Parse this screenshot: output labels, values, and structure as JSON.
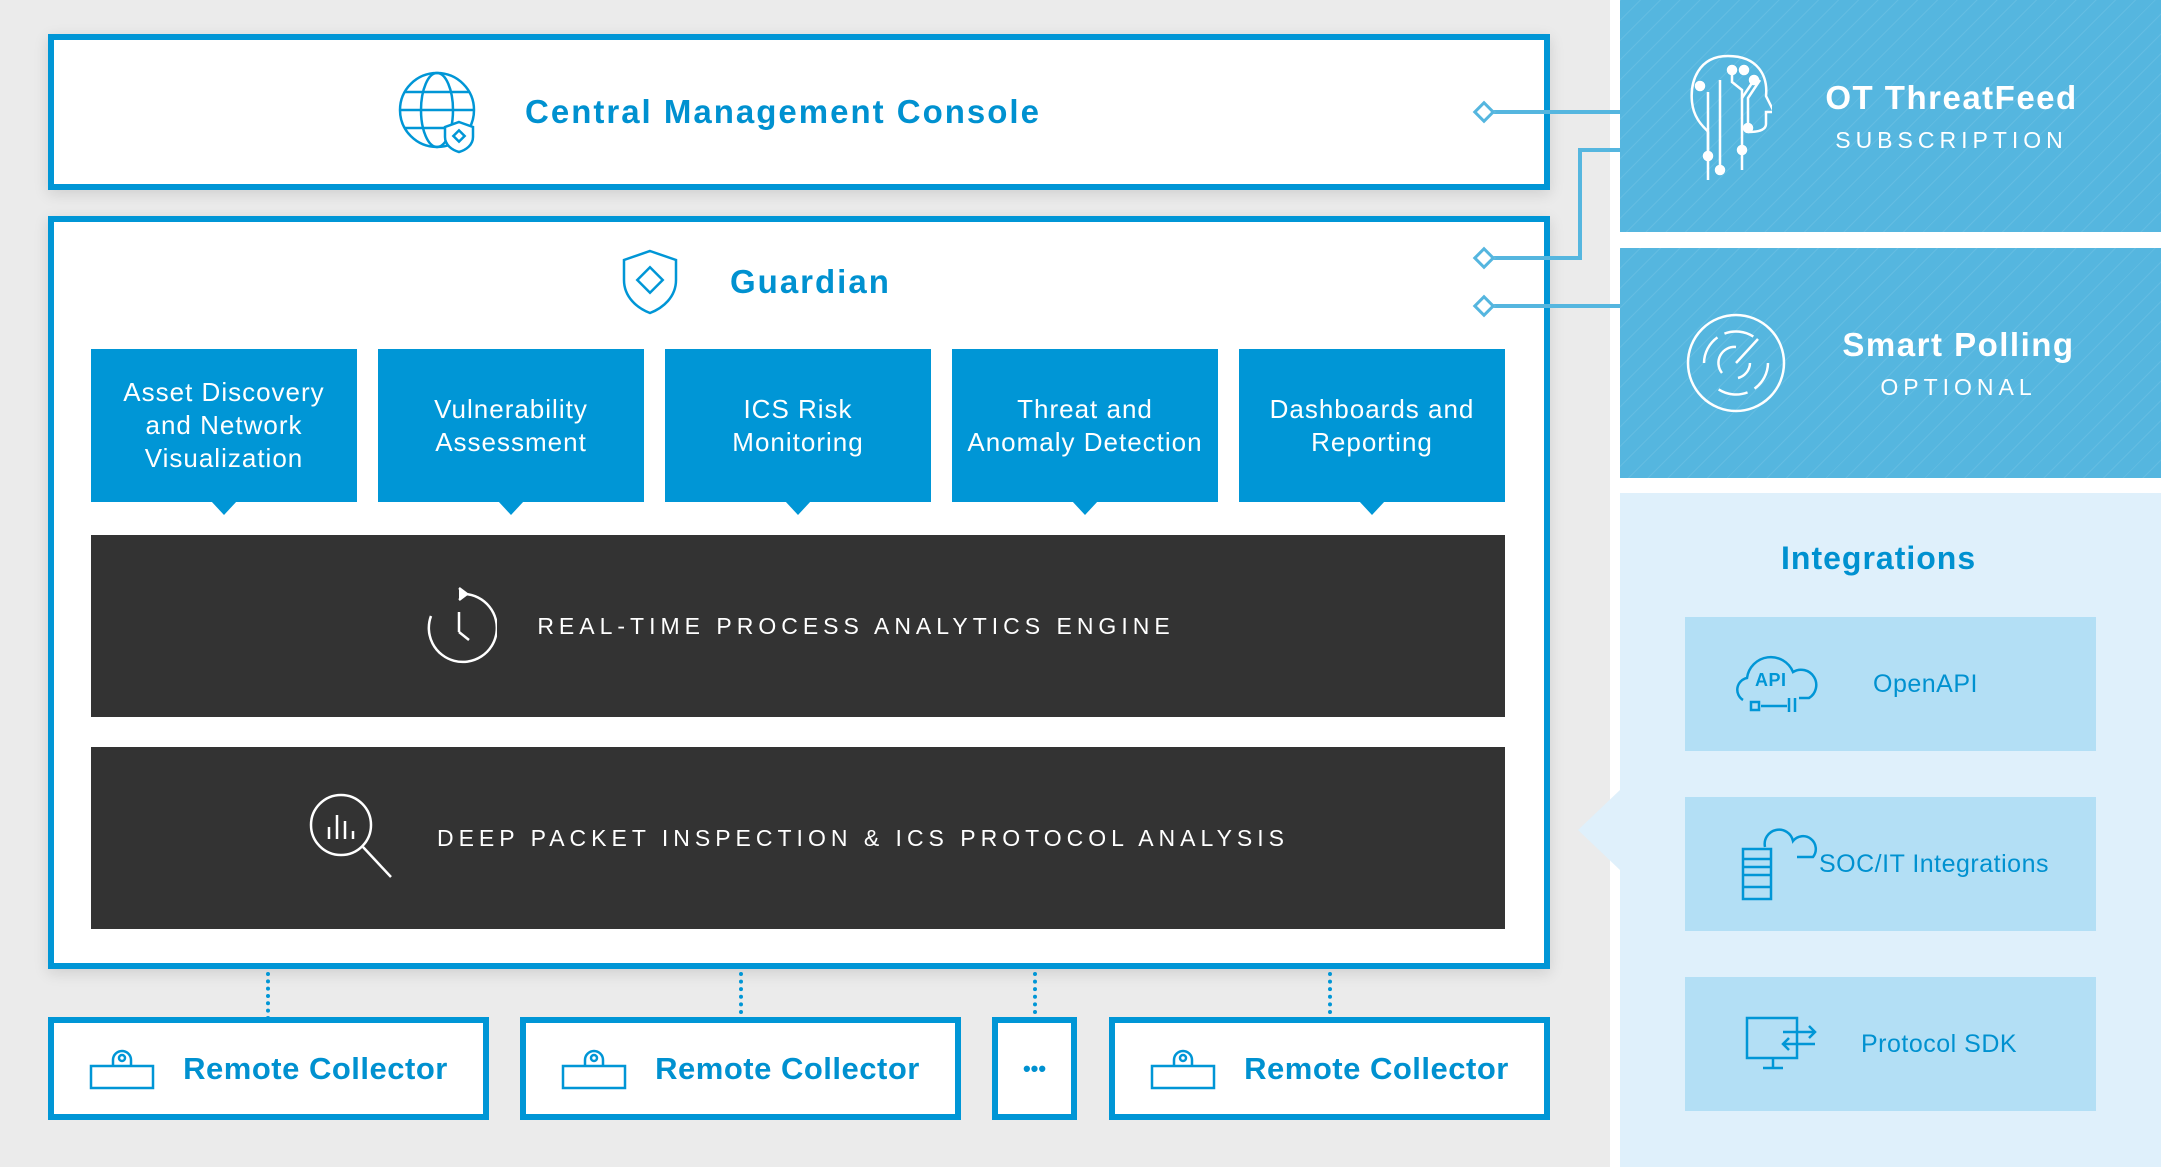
{
  "console": {
    "title": "Central Management Console",
    "icon": "globe-shield-icon"
  },
  "guardian": {
    "title": "Guardian",
    "icon": "shield-diamond-icon",
    "modules": [
      {
        "label": "Asset Discovery and Network Visualization"
      },
      {
        "label": "Vulnerability Assessment"
      },
      {
        "label": "ICS Risk Monitoring"
      },
      {
        "label": "Threat and Anomaly Detection"
      },
      {
        "label": "Dashboards and Reporting"
      }
    ],
    "engines": [
      {
        "label": "REAL-TIME PROCESS ANALYTICS ENGINE",
        "icon": "clock-refresh-icon"
      },
      {
        "label": "DEEP PACKET INSPECTION & ICS PROTOCOL ANALYSIS",
        "icon": "magnifier-chart-icon"
      }
    ]
  },
  "collectors": [
    {
      "label": "Remote Collector"
    },
    {
      "label": "Remote Collector"
    },
    {
      "label": "•••"
    },
    {
      "label": "Remote Collector"
    }
  ],
  "threatfeed": {
    "title": "OT ThreatFeed",
    "subtitle": "SUBSCRIPTION",
    "icon": "ai-head-circuit-icon"
  },
  "polling": {
    "title": "Smart Polling",
    "subtitle": "OPTIONAL",
    "icon": "radar-icon"
  },
  "integrations": {
    "title": "Integrations",
    "items": [
      {
        "label": "OpenAPI",
        "icon_text": "API"
      },
      {
        "label": "SOC/IT Integrations"
      },
      {
        "label": "Protocol SDK"
      }
    ]
  },
  "colors": {
    "primary": "#0096d6",
    "light_blue": "#55b6df",
    "pale_blue": "#dff0fb",
    "tile_blue": "#b3dff5",
    "dark": "#333333",
    "gray_bg": "#ebebeb"
  }
}
